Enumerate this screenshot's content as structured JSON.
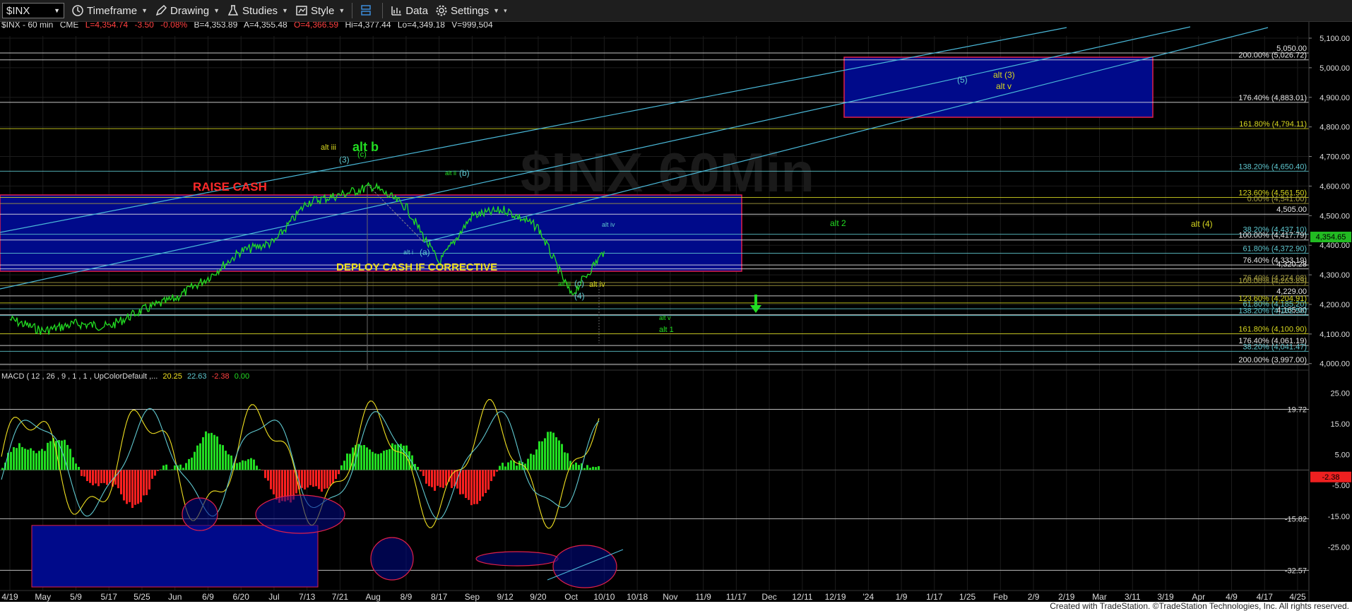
{
  "toolbar": {
    "symbol": "$INX",
    "timeframe_label": "Timeframe",
    "drawing_label": "Drawing",
    "studies_label": "Studies",
    "style_label": "Style",
    "data_label": "Data",
    "settings_label": "Settings"
  },
  "info_line": {
    "symbol": "$INX - 60 min",
    "exchange": "CME",
    "last": "L=4,354.74",
    "chg": "-3.50",
    "pct": "-0.08%",
    "bid": "B=4,353.89",
    "ask": "A=4,355.48",
    "open": "O=4,366.59",
    "hi": "Hi=4,377.44",
    "lo": "Lo=4,349.18",
    "vol": "V=999,504"
  },
  "watermark": "$INX 60Min",
  "last_price_badge": "4,354.65",
  "colors": {
    "price": "#22dd22",
    "fib_white": "#e8e8e8",
    "fib_cyan": "#5fc8d0",
    "fib_yellow": "#d8d820",
    "fib_olive": "#a8a040",
    "box_fill": "#000a8a",
    "box_border": "#e0204a",
    "trend": "#4ab8d8"
  },
  "chart_data": [
    {
      "type": "line",
      "title": "$INX - 60 min",
      "x_tick_labels": [
        "4/19",
        "May",
        "5/9",
        "5/17",
        "5/25",
        "Jun",
        "6/9",
        "6/20",
        "Jul",
        "7/13",
        "7/21",
        "Aug",
        "8/9",
        "8/17",
        "Sep",
        "9/12",
        "9/20",
        "Oct",
        "10/10",
        "10/18",
        "Nov",
        "11/9",
        "11/17",
        "Dec",
        "12/11",
        "12/19",
        "'24",
        "1/9",
        "1/17",
        "1/25",
        "Feb",
        "2/9",
        "2/19",
        "Mar",
        "3/11",
        "3/19",
        "Apr",
        "4/9",
        "4/17",
        "4/25"
      ],
      "y_ticks": [
        4000,
        4100,
        4200,
        4300,
        4400,
        4500,
        4600,
        4700,
        4800,
        4900,
        5000,
        5100
      ],
      "y_tick_labels": [
        "4,000.00",
        "4,100.00",
        "4,200.00",
        "4,300.00",
        "4,400.00",
        "4,500.00",
        "4,600.00",
        "4,700.00",
        "4,800.00",
        "4,900.00",
        "5,000.00",
        "5,100.00"
      ],
      "ylim": [
        3955,
        5140
      ],
      "series": [
        {
          "x": [
            "4/19",
            "May",
            "5/9",
            "5/17",
            "5/25",
            "Jun",
            "6/9",
            "6/20",
            "Jul",
            "7/13",
            "7/21",
            "Aug",
            "8/9",
            "8/17",
            "Sep",
            "9/12",
            "9/20",
            "Oct",
            "10/10"
          ],
          "values": [
            4150,
            4110,
            4135,
            4125,
            4180,
            4220,
            4290,
            4380,
            4410,
            4545,
            4570,
            4600,
            4530,
            4340,
            4500,
            4520,
            4460,
            4230,
            4380
          ]
        }
      ],
      "fib_levels": [
        {
          "value": 5050,
          "label": "5,050.00"
        },
        {
          "value": 5026.72,
          "label": "200.00% (5,026.72)"
        },
        {
          "value": 4883.01,
          "label": "176.40% (4,883.01)"
        },
        {
          "value": 4794.11,
          "label": "161.80% (4,794.11)"
        },
        {
          "value": 4650.4,
          "label": "138.20% (4,650.40)"
        },
        {
          "value": 4561.5,
          "label": "123.60% (4,561.50)"
        },
        {
          "value": 4541.0,
          "label": "0.00% (4,541.00)"
        },
        {
          "value": 4505,
          "label": "4,505.00"
        },
        {
          "value": 4437.1,
          "label": "38.20% (4,437.10)"
        },
        {
          "value": 4417.79,
          "label": "100.00% (4,417.79)"
        },
        {
          "value": 4372.9,
          "label": "61.80% (4,372.90)"
        },
        {
          "value": 4333.19,
          "label": "76.40% (4,333.19)"
        },
        {
          "value": 4320.28,
          "label": "4,320.28"
        },
        {
          "value": 4274.08,
          "label": "76.40% (4,274.08)"
        },
        {
          "value": 4263.89,
          "label": "100.00% (4,263.89)"
        },
        {
          "value": 4229,
          "label": "4,229.00"
        },
        {
          "value": 4204.91,
          "label": "123.60% (4,204.91)"
        },
        {
          "value": 4185.2,
          "label": "61.80% (4,185.20)"
        },
        {
          "value": 4165,
          "label": "4,165.00"
        },
        {
          "value": 4162.5,
          "label": "138.20% (4,162.50)"
        },
        {
          "value": 4100.9,
          "label": "161.80% (4,100.90)"
        },
        {
          "value": 4061.19,
          "label": "176.40% (4,061.19)"
        },
        {
          "value": 4041.47,
          "label": "38.20% (4,041.47)"
        },
        {
          "value": 3997.0,
          "label": "200.00% (3,997.00)"
        }
      ],
      "annotations": [
        "RAISE CASH",
        "DEPLOY CASH IF CORRECTIVE",
        "alt b",
        "alt iii",
        "(3)",
        "(c)",
        "alt ii",
        "(b)",
        "alt i",
        "(a)",
        "alt iv",
        "alt iii",
        "(c)",
        "alt iv",
        "(4)",
        "alt 2",
        "alt (4)",
        "alt v",
        "alt 1",
        "(5)",
        "alt (3)",
        "alt v"
      ]
    },
    {
      "type": "line",
      "title": "MACD ( 12 , 26 , 9 , 1 , 1 , UpColorDefault ,...",
      "legend": [
        "20.25",
        "22.63",
        "-2.38",
        "0.00"
      ],
      "y_ticks": [
        25,
        15,
        5,
        -5,
        -15,
        -25
      ],
      "y_tick_labels": [
        "25.00",
        "15.00",
        "5.00",
        "-5.00",
        "-15.00",
        "-25.00"
      ],
      "ylim": [
        -38,
        29
      ],
      "reference_levels": [
        {
          "value": 19.72,
          "label": "19.72"
        },
        {
          "value": -15.82,
          "label": "-15.82"
        },
        {
          "value": -32.57,
          "label": "-32.57"
        }
      ],
      "last_badge": "-2.38"
    }
  ],
  "footer": {
    "credit": "Created with TradeStation. ©TradeStation Technologies, Inc. All rights reserved."
  }
}
